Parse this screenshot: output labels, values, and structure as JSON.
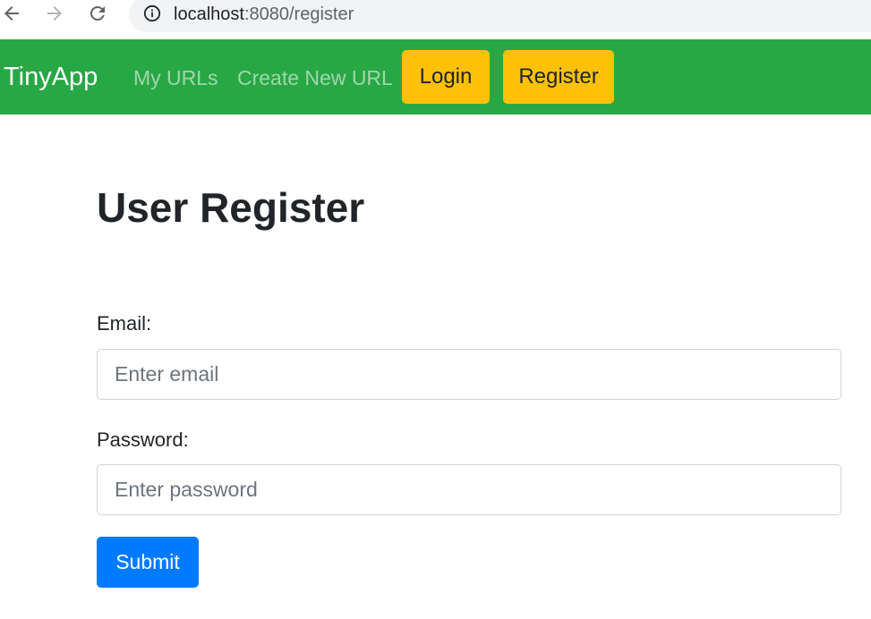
{
  "browser": {
    "url_host": "localhost",
    "url_rest": ":8080/register"
  },
  "navbar": {
    "brand": "TinyApp",
    "links": [
      "My URLs",
      "Create New URL"
    ],
    "buttons": [
      "Login",
      "Register"
    ],
    "colors": {
      "navbar": "#28a745",
      "button": "#ffc107"
    }
  },
  "main": {
    "title": "User Register",
    "email_label": "Email:",
    "email_placeholder": "Enter email",
    "email_value": "",
    "password_label": "Password:",
    "password_placeholder": "Enter password",
    "password_value": "",
    "submit_label": "Submit",
    "submit_color": "#007bff"
  }
}
